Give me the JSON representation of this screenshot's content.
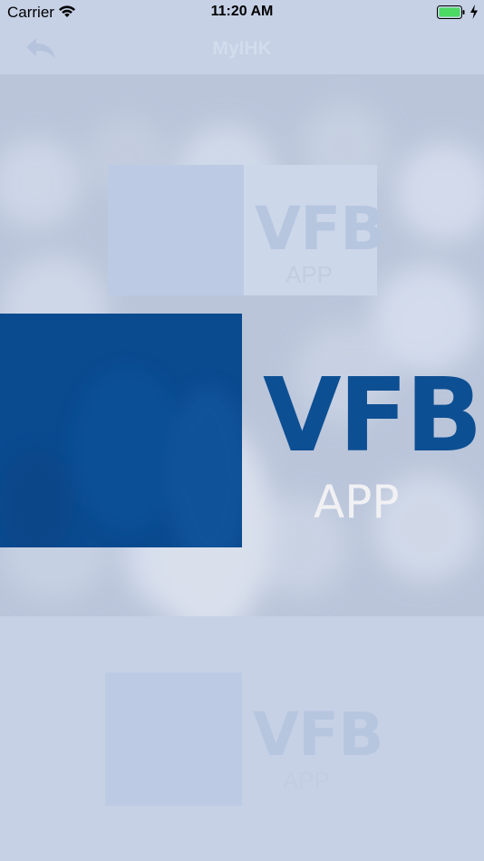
{
  "status_bar": {
    "carrier": "Carrier",
    "time": "11:20 AM",
    "wifi_icon": "wifi-icon",
    "battery_icon": "battery-icon",
    "charging_icon": "bolt-icon"
  },
  "nav": {
    "title": "MyIHK",
    "back_icon": "reply-arrow-icon"
  },
  "logo": {
    "main_text": "VFB",
    "sub_text": "APP",
    "ghost_top_text": "VFB",
    "ghost_top_sub": "APP",
    "ghost_bottom_text": "VFB",
    "ghost_bottom_sub": "APP"
  },
  "colors": {
    "brand_blue": "#0a4a8f",
    "background": "#c6d1e6"
  }
}
